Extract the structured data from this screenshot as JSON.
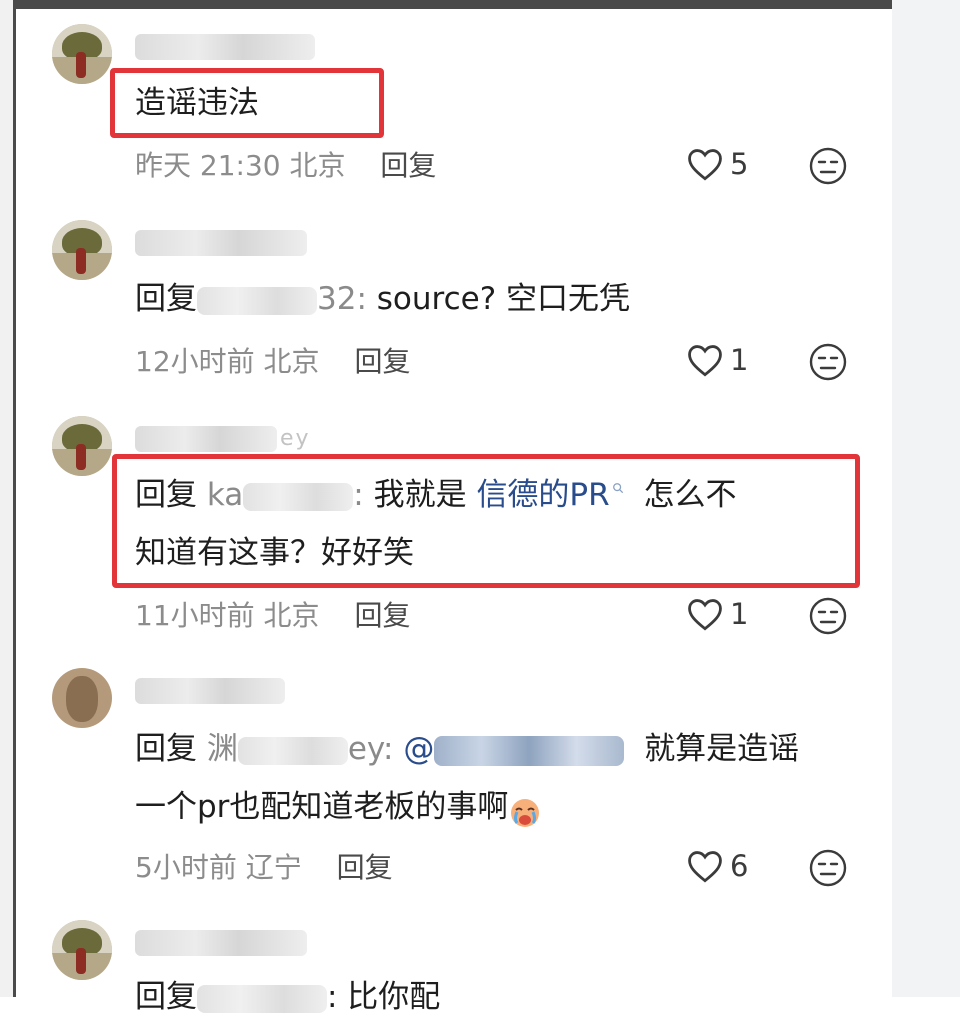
{
  "comments": [
    {
      "content": "造谣违法",
      "time": "昨天 21:30",
      "location": "北京",
      "reply_label": "回复",
      "likes": "5"
    },
    {
      "username_hint": "",
      "reply_prefix": "回复",
      "reply_to_suffix": "32:",
      "content": "source? 空口无凭",
      "time": "12小时前",
      "location": "北京",
      "reply_label": "回复",
      "likes": "1"
    },
    {
      "username_hint": "ey",
      "reply_prefix": "回复",
      "reply_to_prefix": "ka",
      "reply_to_suffix": ":",
      "content_prefix": "我就是",
      "link_text": "信德的PR",
      "content_line1_suffix": "怎么不",
      "content_line2": "知道有这事？好好笑",
      "time": "11小时前",
      "location": "北京",
      "reply_label": "回复",
      "likes": "1"
    },
    {
      "reply_prefix": "回复",
      "reply_to_prefix": "渊",
      "reply_to_suffix": "ey:",
      "mention_prefix": "@",
      "content_line1_suffix": "就算是造谣",
      "content_line2": "一个pr也配知道老板的事啊",
      "time": "5小时前",
      "location": "辽宁",
      "reply_label": "回复",
      "likes": "6"
    },
    {
      "username_hint": "",
      "reply_prefix": "回复",
      "content": ": 比你配"
    }
  ],
  "icons": {
    "like": "heart-outline-icon",
    "dislike": "neutral-face-icon",
    "emoji": "crying-face-emoji"
  },
  "colors": {
    "highlight": "#e2353a",
    "link": "#294c8c",
    "meta": "#8c8c8c"
  }
}
